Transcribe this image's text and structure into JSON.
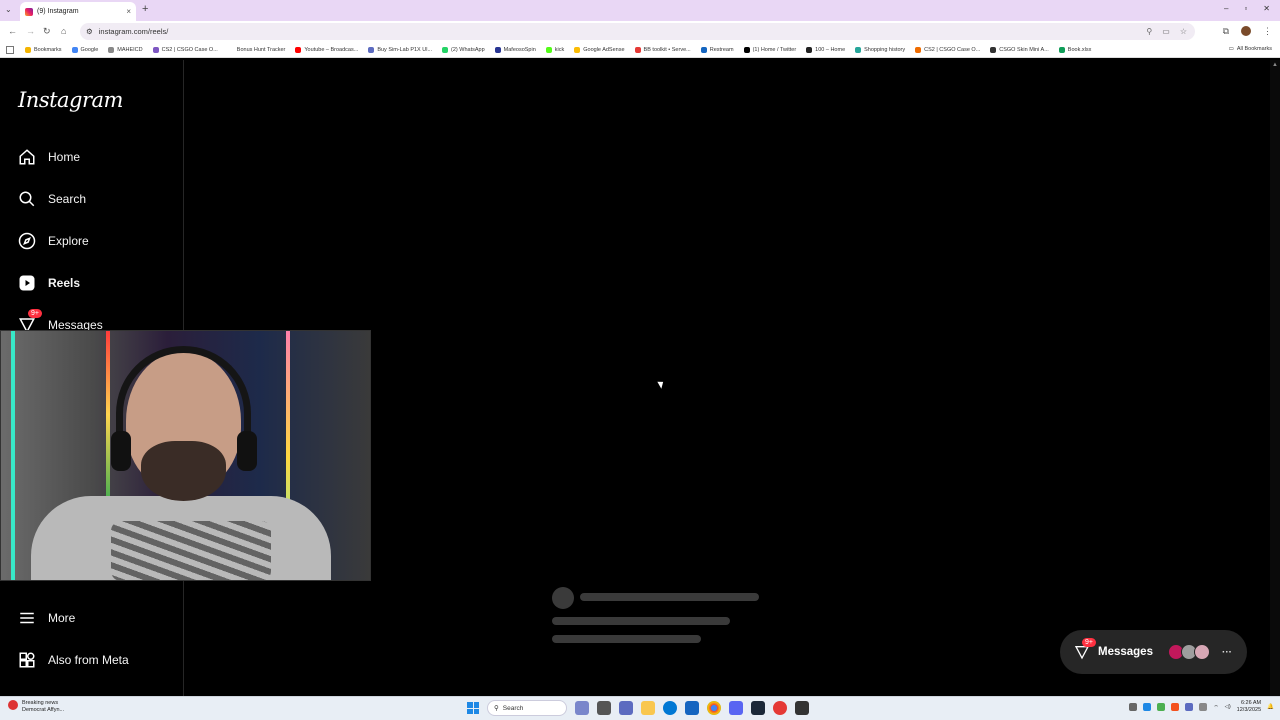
{
  "browser": {
    "tab_title": "(9) Instagram",
    "tab_close": "×",
    "new_tab": "+",
    "url": "instagram.com/reels/",
    "window_controls": [
      "–",
      "▫",
      "✕"
    ],
    "bookmarks": [
      "Bookmarks",
      "Google",
      "MAHEICD",
      "CS2 | CSGO Case O...",
      "Bonus Hunt Tracker",
      "Youtube – Broadcas...",
      "Buy Sim-Lab P1X Ul...",
      "(2) WhatsApp",
      "MafeosoSpin",
      "kick",
      "Google AdSense",
      "BB toolkit • Serve...",
      "Restream",
      "(1) Home / Twitter",
      "100 – Home",
      "Shopping history",
      "CS2 | CSGO Case O...",
      "CSGO Skin Mini A...",
      "Book.xlsx"
    ],
    "all_bookmarks": "All Bookmarks"
  },
  "instagram": {
    "logo": "Instagram",
    "nav": {
      "home": "Home",
      "search": "Search",
      "explore": "Explore",
      "reels": "Reels",
      "messages": "Messages",
      "more": "More",
      "also_from_meta": "Also from Meta"
    },
    "messages_badge": "9+",
    "float_messages": {
      "label": "Messages",
      "badge": "9+",
      "more": "···"
    }
  },
  "taskbar": {
    "news_title": "Breaking news",
    "news_subtitle": "Democrat Affyn...",
    "search_placeholder": "Search",
    "time": "6:26 AM",
    "date": "12/3/2025"
  },
  "colors": {
    "background": "#000000",
    "badge": "#ff3040",
    "pill": "#262626"
  }
}
